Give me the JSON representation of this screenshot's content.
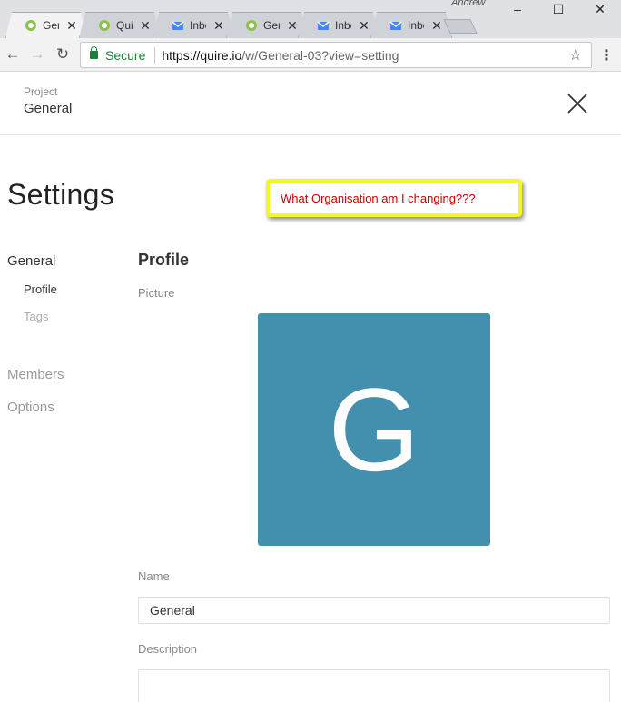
{
  "browser": {
    "tabs": [
      {
        "label": "Gen",
        "favicon": "quire-icon",
        "active": true
      },
      {
        "label": "Quir",
        "favicon": "quire-icon",
        "active": false
      },
      {
        "label": "Inbo",
        "favicon": "inbox-icon",
        "active": false
      },
      {
        "label": "Gen",
        "favicon": "quire-icon",
        "active": false
      },
      {
        "label": "Inbo",
        "favicon": "inbox-icon",
        "active": false
      },
      {
        "label": "Inbo",
        "favicon": "inbox-icon",
        "active": false
      }
    ],
    "profile_name": "Andrew",
    "secure_label": "Secure",
    "url_host": "https://quire.io",
    "url_path": "/w/General-03?view=setting",
    "colors": {
      "secure": "#188038",
      "quire": "#4caf50",
      "inbox": "#4285f4"
    }
  },
  "project": {
    "label": "Project",
    "name": "General"
  },
  "settings": {
    "title": "Settings",
    "annotation": "What Organisation am I changing???",
    "nav": {
      "general": "General",
      "profile": "Profile",
      "tags": "Tags",
      "members": "Members",
      "options": "Options"
    },
    "profile": {
      "section_title": "Profile",
      "picture_label": "Picture",
      "avatar_letter": "G",
      "avatar_color": "#438fae",
      "name_label": "Name",
      "name_value": "General",
      "description_label": "Description",
      "description_value": ""
    }
  }
}
